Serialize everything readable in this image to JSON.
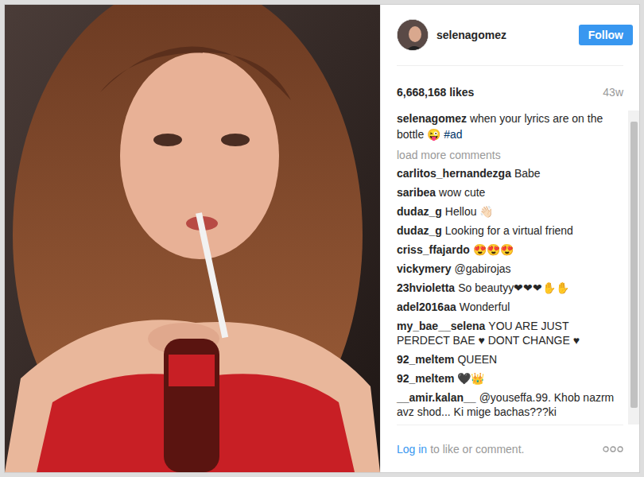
{
  "post": {
    "username": "selenagomez",
    "follow_button": "Follow",
    "likes": "6,668,168 likes",
    "age": "43w",
    "caption": {
      "user": "selenagomez",
      "text": "when your lyrics are on the bottle 😜",
      "hashtag": "#ad"
    },
    "load_more": "load more comments",
    "comments": [
      {
        "user": "carlitos_hernandezga",
        "text": "Babe"
      },
      {
        "user": "saribea",
        "text": "wow cute"
      },
      {
        "user": "dudaz_g",
        "text": "Hellou 👋🏻"
      },
      {
        "user": "dudaz_g",
        "text": "Looking for a virtual friend"
      },
      {
        "user": "criss_ffajardo",
        "text": "😍😍😍"
      },
      {
        "user": "vickymery",
        "text": "@gabirojas"
      },
      {
        "user": "23hvioletta",
        "text": "So beautyy❤❤❤✋✋"
      },
      {
        "user": "adel2016aa",
        "text": "Wonderful"
      },
      {
        "user": "my_bae__selena",
        "text": "YOU ARE JUST PERDECT BAE ♥ DONT CHANGE ♥"
      },
      {
        "user": "92_meltem",
        "text": "QUEEN"
      },
      {
        "user": "92_meltem",
        "text": "🖤👑"
      },
      {
        "user": "__amir.kalan__",
        "text": "@youseffa.99. Khob nazrm avz shod... Ki mige bachas???ki"
      }
    ],
    "footer": {
      "login_link": "Log in",
      "login_text": "to like or comment."
    }
  }
}
